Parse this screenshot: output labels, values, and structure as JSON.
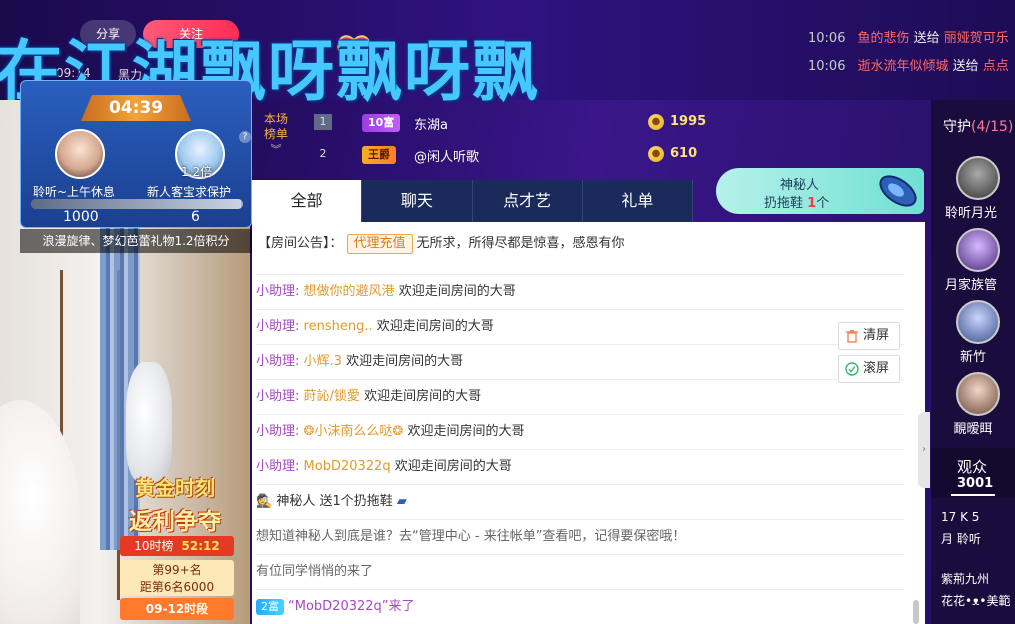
{
  "header": {
    "big_title": "在江湖飘呀飘呀飘",
    "share_label": "分享",
    "follow_label": "关注",
    "small_time": "09:14",
    "small_label": "黑力"
  },
  "gift_feed": [
    {
      "time": "10:06",
      "user": "鱼的悲伤",
      "action": "送给",
      "target": "丽娅贺可乐"
    },
    {
      "time": "10:06",
      "user": "逝水流年似倾城",
      "action": "送给",
      "target": "点点"
    }
  ],
  "pk": {
    "timer": "04:39",
    "multiplier": "1.2倍",
    "left_name": "聆听~上午休息",
    "right_name": "新人客宝求保护",
    "left_score": "1000",
    "right_score": "6",
    "left_ratio": 0.99,
    "help": "?",
    "note": "浪漫旋律、梦幻芭蕾礼物1.2倍积分"
  },
  "golden": {
    "title1": "黄金时刻",
    "title2": "返利争夺",
    "rank_label": "10时榜",
    "countdown": "52:12",
    "line1": "第99+名",
    "line2": "距第6名6000",
    "slot": "09-12时段"
  },
  "rank": {
    "label1": "本场",
    "label2": "榜单",
    "chev": "︾",
    "rows": [
      {
        "num": "1",
        "badge": "10富",
        "name": "东湖a",
        "score": "1995"
      },
      {
        "num": "2",
        "badge": "王爵",
        "name": "@闲人听歌",
        "score": "610"
      }
    ]
  },
  "mystery": {
    "line1": "神秘人",
    "line2_prefix": "扔拖鞋",
    "count": "1",
    "line2_suffix": "个"
  },
  "tabs": [
    "全部",
    "聊天",
    "点才艺",
    "礼单"
  ],
  "chat": {
    "notice_label": "【房间公告】：",
    "notice_tag": "代理充值",
    "notice_text": "无所求，所得尽都是惊喜，感恩有你",
    "helper_label": "小助理:",
    "welcome_text": "欢迎走间房间的大哥",
    "welcomes": [
      "想做你的避风港",
      "rensheng..",
      "小辉.3",
      "莳訫/锁愛",
      "❂小沫南么么哒❂",
      "MobD20322q"
    ],
    "gift_msg": "神秘人 送1个扔拖鞋",
    "tip_msg": "想知道神秘人到底是谁？去“管理中心 - 来往帐单”查看吧，记得要保密哦！",
    "join_msg": "有位同学悄悄的来了",
    "last_badge": "2富",
    "last_msg": "“MobD20322q”来了",
    "clear_label": "清屏",
    "scroll_label": "滚屏"
  },
  "guard": {
    "title": "守护",
    "count": "(4/15)",
    "members": [
      "聆听月光",
      "月家族管",
      "新竹",
      "靦暧眲"
    ]
  },
  "audience": {
    "label": "观众",
    "count": "3001",
    "viewers": [
      "17 K 5",
      "月 聆听",
      "紫荊九州",
      "花花•ᴥ•美範"
    ]
  }
}
